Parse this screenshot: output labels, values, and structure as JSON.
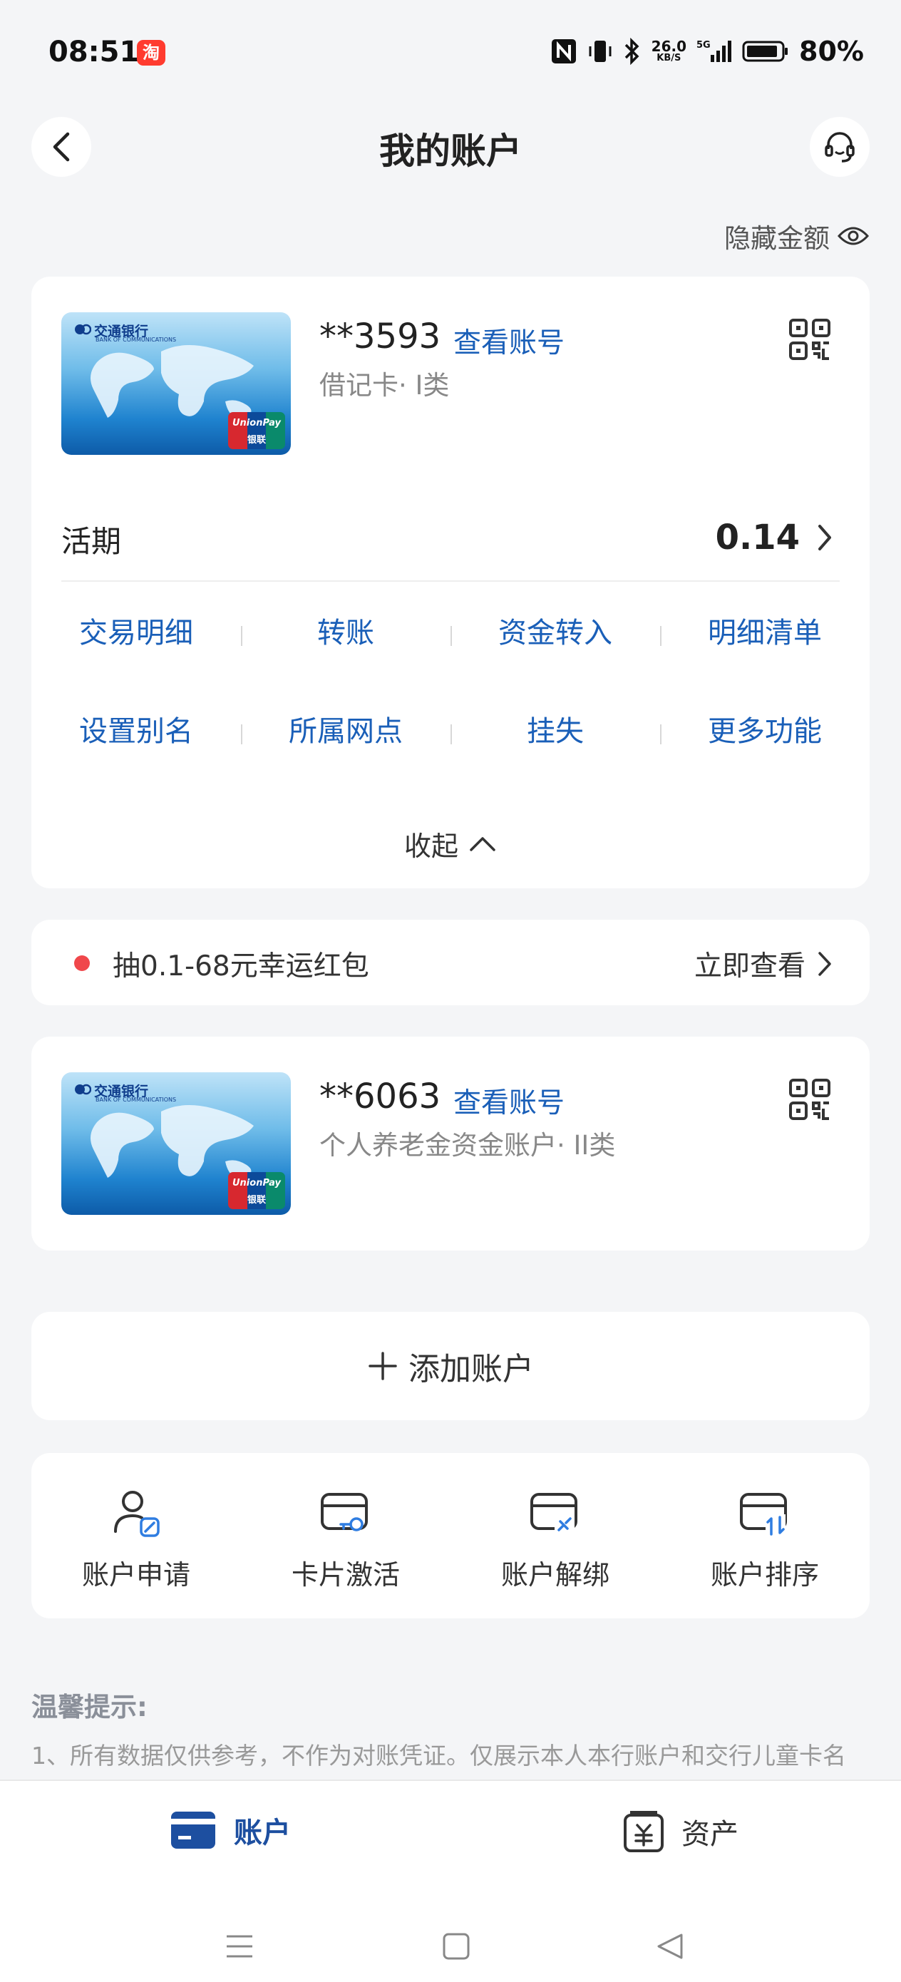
{
  "status": {
    "time": "08:51",
    "app_badge": "淘",
    "net_speed": "26.0",
    "net_unit": "KB/S",
    "battery": "80%"
  },
  "nav": {
    "title": "我的账户"
  },
  "hide_amount": "隐藏金额",
  "cards": [
    {
      "bank": "交通银行",
      "bank_en": "BANK OF COMMUNICATIONS",
      "unionpay": "UnionPay",
      "unionpay_cn": "银联",
      "number": "**3593",
      "view": "查看账号",
      "type": "借记卡· I类"
    },
    {
      "bank": "交通银行",
      "bank_en": "BANK OF COMMUNICATIONS",
      "unionpay": "UnionPay",
      "unionpay_cn": "银联",
      "number": "**6063",
      "view": "查看账号",
      "type": "个人养老金资金账户· II类"
    }
  ],
  "balance": {
    "label": "活期",
    "value": "0.14"
  },
  "functions": [
    [
      "交易明细",
      "转账",
      "资金转入",
      "明细清单"
    ],
    [
      "设置别名",
      "所属网点",
      "挂失",
      "更多功能"
    ]
  ],
  "collapse": "收起",
  "promo": {
    "text": "抽0.1-68元幸运红包",
    "cta": "立即查看"
  },
  "add_account": "添加账户",
  "tools": [
    {
      "label": "账户申请",
      "icon": "user-edit-icon"
    },
    {
      "label": "卡片激活",
      "icon": "card-key-icon"
    },
    {
      "label": "账户解绑",
      "icon": "card-unlink-icon"
    },
    {
      "label": "账户排序",
      "icon": "card-sort-icon"
    }
  ],
  "tips": {
    "title": "温馨提示:",
    "body": "1、所有数据仅供参考，不作为对账凭证。仅展示本人本行账户和交行儿童卡名"
  },
  "tabs": [
    {
      "label": "账户",
      "icon": "card-icon",
      "active": true
    },
    {
      "label": "资产",
      "icon": "yuan-wallet-icon",
      "active": false
    }
  ],
  "colors": {
    "accent": "#1a5fb8",
    "active_tab": "#1d4fa0",
    "promo_dot": "#f0474b"
  }
}
